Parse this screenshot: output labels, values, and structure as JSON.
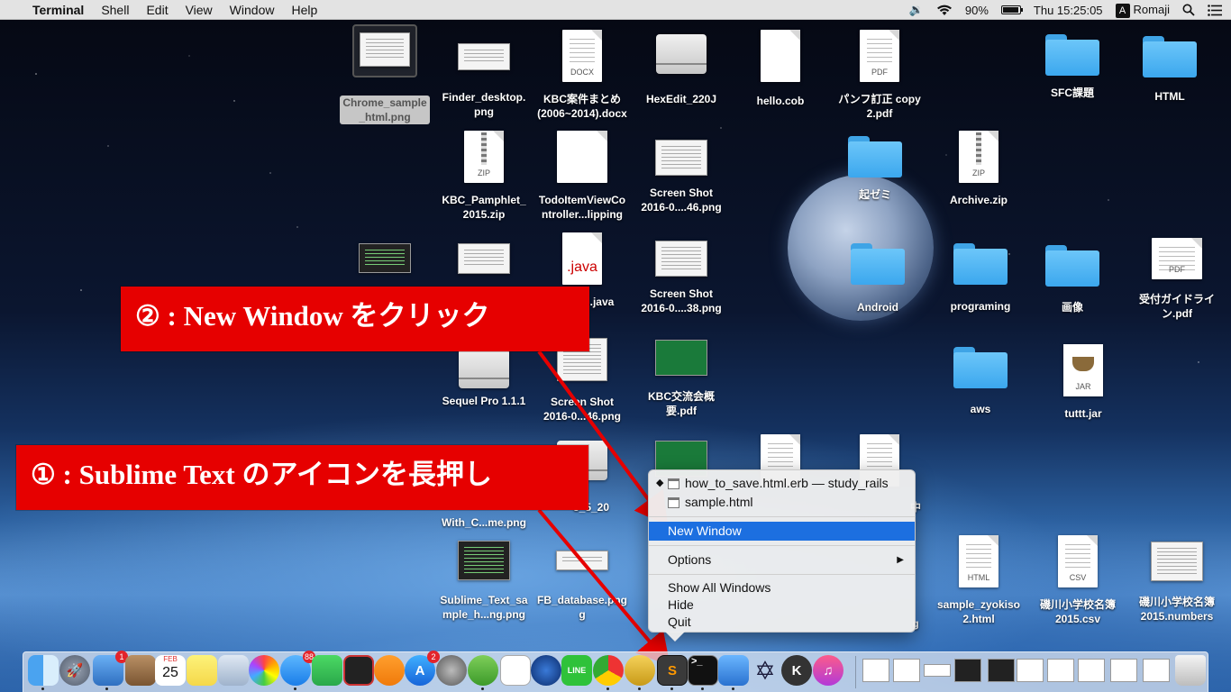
{
  "menubar": {
    "app_name": "Terminal",
    "items": [
      "Shell",
      "Edit",
      "View",
      "Window",
      "Help"
    ],
    "battery": "90%",
    "clock": "Thu 15:25:05",
    "input_mode_letter": "A",
    "input_mode": "Romaji"
  },
  "desktop": {
    "chrome_sample": "Chrome_sample\n_html.png",
    "finder_desktop": "Finder_desktop.\npng",
    "kbc_docx": "KBC案件まとめ\n(2006~2014).docx",
    "docx_tag": "DOCX",
    "hexedit": "HexEdit_220J",
    "hello_cob": "hello.cob",
    "pamph_pdf": "パンフ訂正 copy\n2.pdf",
    "pdf_tag": "PDF",
    "sfc": "SFC課題",
    "html_folder": "HTML",
    "kbc_zip": "KBC_Pamphlet_\n2015.zip",
    "zip_tag": "ZIP",
    "todo": "TodoItemViewCo\nntroller...lipping",
    "shot46a": "Screen Shot\n2016-0....46.png",
    "kizemi": "起ゼミ",
    "archive": "Archive.zip",
    "java_tag": ".java",
    "java_file": ".java",
    "shot38": "Screen Shot\n2016-0....38.png",
    "android": "Android",
    "programing": "programing",
    "gazou": "画像",
    "uketsuke": "受付ガイドライ\nン.pdf",
    "sequel": "Sequel Pro 1.1.1",
    "shot46b": "Screen Shot\n2016-0...46.png",
    "kbc_pdf": "KBC交流会概\n要.pdf",
    "aws": "aws",
    "tuttt": "tuttt.jar",
    "jar_tag": "JAR",
    "with_c": "With_C...me.png",
    "partial_520": "3_5_20",
    "partial_naka": "中",
    "sublime_png": "Sublime_Text_sa\nmple_h...ng.png",
    "fb_db": "FB_database.png\ng",
    "partial_g": "g",
    "zyokiso": "sample_zyokiso\n2.html",
    "html_tag": "HTML",
    "iso_csv": "磯川小学校名簿\n2015.csv",
    "csv_tag": "CSV",
    "iso_numbers": "磯川小学校名簿\n2015.numbers"
  },
  "annotations": {
    "step2": "② : New Window をクリック",
    "step1": "① : Sublime Text のアイコンを長押し"
  },
  "context_menu": {
    "window1": "how_to_save.html.erb — study_rails",
    "window2": "sample.html",
    "new_window": "New Window",
    "options": "Options",
    "show_all": "Show All Windows",
    "hide": "Hide",
    "quit": "Quit"
  },
  "dock": {
    "calendar_month": "FEB",
    "calendar_day": "25",
    "badge_1": "1",
    "badge_2": "88",
    "badge_3": "2",
    "line_label": "LINE"
  }
}
